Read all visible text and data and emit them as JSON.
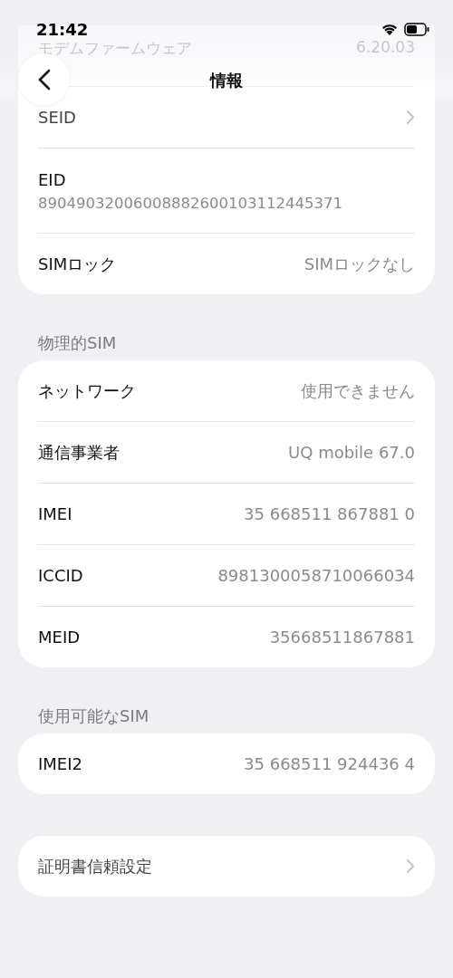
{
  "status_bar": {
    "time": "21:42"
  },
  "nav": {
    "title": "情報"
  },
  "sections": [
    {
      "rows": [
        {
          "kind": "faded",
          "label": "モデムファームウェア",
          "value": "6.20.03"
        },
        {
          "kind": "link",
          "label": "SEID"
        },
        {
          "kind": "stacked",
          "label": "EID",
          "value": "89049032006008882600103112445371"
        },
        {
          "kind": "pair",
          "label": "SIMロック",
          "value": "SIMロックなし"
        }
      ]
    },
    {
      "header": "物理的SIM",
      "rows": [
        {
          "kind": "pair",
          "label": "ネットワーク",
          "value": "使用できません"
        },
        {
          "kind": "pair",
          "label": "通信事業者",
          "value": "UQ mobile 67.0"
        },
        {
          "kind": "pair",
          "label": "IMEI",
          "value": "35 668511 867881 0"
        },
        {
          "kind": "pair",
          "label": "ICCID",
          "value": "8981300058710066034"
        },
        {
          "kind": "pair",
          "label": "MEID",
          "value": "35668511867881"
        }
      ]
    },
    {
      "header": "使用可能なSIM",
      "rows": [
        {
          "kind": "pair",
          "label": "IMEI2",
          "value": "35 668511 924436 4"
        }
      ]
    },
    {
      "rows": [
        {
          "kind": "link",
          "label": "証明書信頼設定"
        }
      ]
    }
  ]
}
